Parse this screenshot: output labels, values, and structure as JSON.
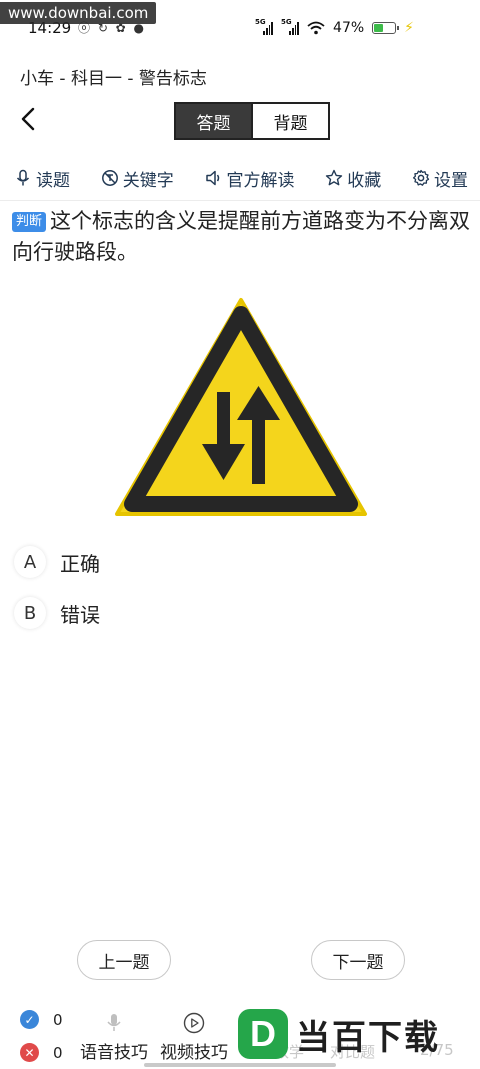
{
  "status_bar": {
    "watermark": "www.downbai.com",
    "time": "14:29",
    "status_glyphs": "ⓞ ↻ ✿ ●",
    "signal_labels": [
      "5G",
      "5G"
    ],
    "battery_percent": "47%",
    "battery_level": 0.47,
    "battery_color": "#3dbb4a"
  },
  "breadcrumb": "小车 - 科目一 - 警告标志",
  "header": {
    "back_icon": "chevron-left-icon",
    "tabs": [
      {
        "label": "答题",
        "active": true
      },
      {
        "label": "背题",
        "active": false
      }
    ]
  },
  "toolbar": {
    "items": [
      {
        "icon": "microphone-icon",
        "label": "读题"
      },
      {
        "icon": "keyword-off-icon",
        "label": "关键字"
      },
      {
        "icon": "speaker-icon",
        "label": "官方解读"
      },
      {
        "icon": "star-icon",
        "label": "收藏"
      },
      {
        "icon": "gear-icon",
        "label": "设置"
      }
    ]
  },
  "question": {
    "type": "判断",
    "text": "这个标志的含义是提醒前方道路变为不分离双向行驶路段。",
    "sign_image": "two-way-traffic-warning-sign",
    "accent": "#3d8de8"
  },
  "options": [
    {
      "key": "A",
      "text": "正确"
    },
    {
      "key": "B",
      "text": "错误"
    }
  ],
  "navigation": {
    "prev": "上一题",
    "next": "下一题"
  },
  "bottom": {
    "correct_count": "0",
    "wrong_count": "0",
    "voice_tips": "语音技巧",
    "video_tips": "视频技巧",
    "faded_items": [
      "精选教学",
      "对比题",
      "2/75"
    ],
    "watermark_logo_letter": "D",
    "watermark_logo_text": "当百下载"
  }
}
